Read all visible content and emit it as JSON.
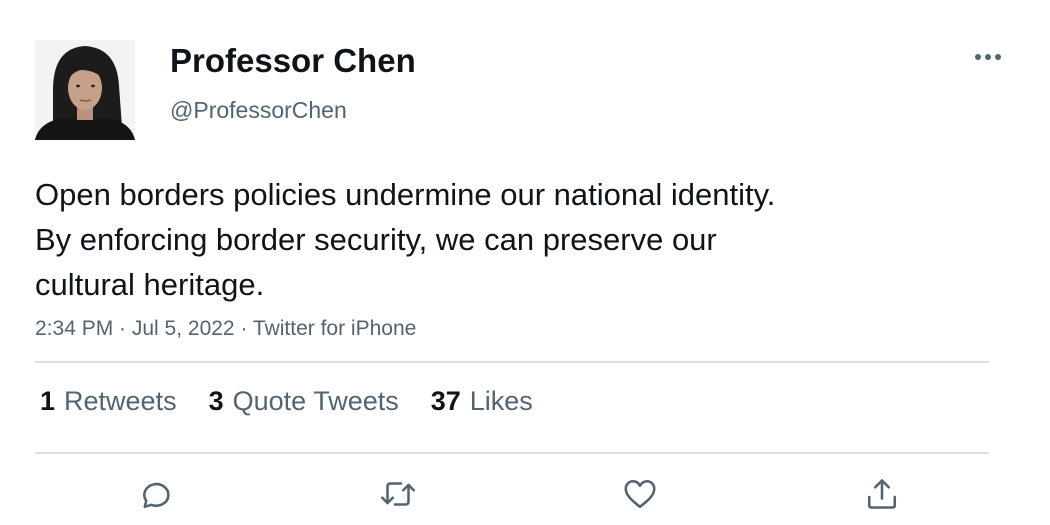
{
  "user": {
    "display_name": "Professor Chen",
    "handle": "@ProfessorChen"
  },
  "tweet": {
    "text_lines": [
      "Open borders policies undermine our national identity.",
      "By enforcing border security, we can preserve our",
      "cultural heritage."
    ],
    "meta": "2:34 PM · Jul 5, 2022 · Twitter for iPhone"
  },
  "stats": {
    "retweets": {
      "count": "1",
      "label": "Retweets"
    },
    "quote_tweets": {
      "count": "3",
      "label": "Quote Tweets"
    },
    "likes": {
      "count": "37",
      "label": "Likes"
    }
  },
  "icons": {
    "more": "more-horizontal-icon",
    "reply": "reply-icon",
    "retweet": "retweet-icon",
    "like": "heart-icon",
    "share": "share-icon"
  },
  "colors": {
    "text": "#0f1419",
    "secondary": "#536471",
    "divider": "#dcdfe2"
  }
}
